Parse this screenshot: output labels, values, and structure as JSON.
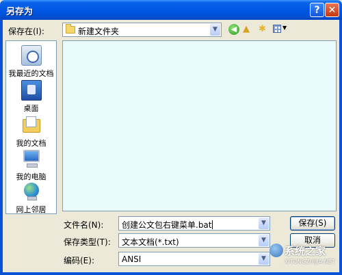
{
  "window": {
    "title": "另存为",
    "help_label": "?",
    "close_label": "✕"
  },
  "toolbar": {
    "save_in_label": "保存在(I):",
    "save_in_value": "新建文件夹",
    "back_icon": "back-arrow-icon",
    "up_icon": "up-folder-icon",
    "new_folder_icon": "new-folder-icon",
    "views_icon": "views-menu-icon"
  },
  "places": [
    {
      "label": "我最近的文档",
      "icon": "recent-documents-icon"
    },
    {
      "label": "桌面",
      "icon": "desktop-icon"
    },
    {
      "label": "我的文档",
      "icon": "my-documents-icon"
    },
    {
      "label": "我的电脑",
      "icon": "my-computer-icon"
    },
    {
      "label": "网上邻居",
      "icon": "network-places-icon"
    }
  ],
  "form": {
    "filename_label": "文件名(N):",
    "filename_value": "创建公文包右键菜单.bat",
    "filetype_label": "保存类型(T):",
    "filetype_value": "文本文档(*.txt)",
    "encoding_label": "编码(E):",
    "encoding_value": "ANSI"
  },
  "buttons": {
    "save": "保存(S)",
    "cancel": "取消"
  },
  "watermark": {
    "brand": "系统之家",
    "url": "XITONGZHIJIA.NET"
  },
  "colors": {
    "titlebar": "#0058E6",
    "dialog_bg": "#ECE9D8",
    "file_list_bg": "#E9FBFB"
  }
}
